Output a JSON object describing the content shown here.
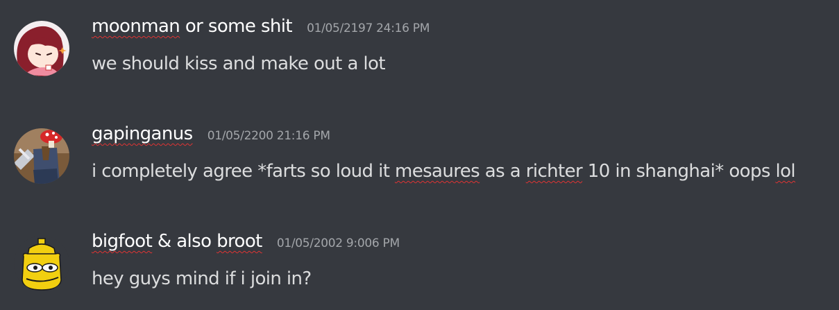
{
  "messages": [
    {
      "avatar": "anime-girl-avatar",
      "username_parts": [
        "moonman",
        " or some shit"
      ],
      "timestamp": "01/05/2197 24:16 PM",
      "content_parts": [
        "we should kiss and make out a lot"
      ]
    },
    {
      "avatar": "mushroom-knight-avatar",
      "username_parts": [
        "gapinganus"
      ],
      "timestamp": "01/05/2200 21:16 PM",
      "content_parts": [
        "i completely agree *farts so loud it ",
        "mesaures",
        " as a ",
        "richter",
        " 10 in shanghai* oops ",
        "lol"
      ]
    },
    {
      "avatar": "mustard-pepe-avatar",
      "username_parts": [
        "bigfoot",
        " & also ",
        "broot"
      ],
      "timestamp": "01/05/2002 9:006 PM",
      "content_parts": [
        "hey guys mind if i join in?"
      ]
    }
  ],
  "colors": {
    "background": "#36393f",
    "username": "#ffffff",
    "message_text": "#dcddde",
    "timestamp": "#a3a6aa",
    "spellcheck_underline": "#e03333"
  }
}
